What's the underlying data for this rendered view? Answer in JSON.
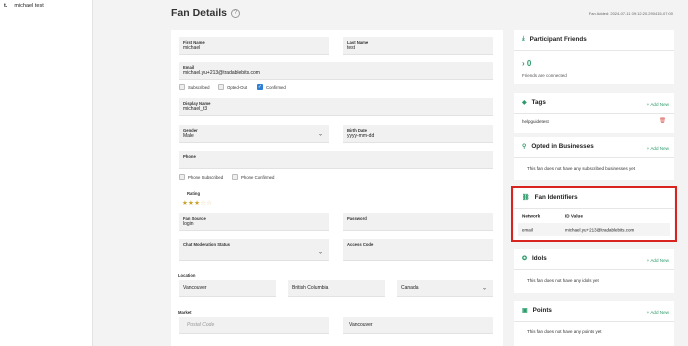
{
  "sidebar": {
    "items": [
      {
        "marker": "t.",
        "label": "michael test"
      }
    ]
  },
  "header": {
    "title": "Fan Details",
    "help_icon": "?",
    "fan_added": "Fan Added: 2024-07-11 09:12:20.290415-07:00"
  },
  "form": {
    "first_name": {
      "label": "First Name",
      "value": "michael"
    },
    "last_name": {
      "label": "Last Name",
      "value": "test"
    },
    "email": {
      "label": "Email",
      "value": "michael.yu+213@tradablebits.com"
    },
    "email_options": [
      {
        "label": "Subscribed",
        "checked": false
      },
      {
        "label": "Opted-Out",
        "checked": false
      },
      {
        "label": "Confirmed",
        "checked": true
      }
    ],
    "display_name": {
      "label": "Display Name",
      "value": "michael_t3"
    },
    "gender": {
      "label": "Gender",
      "value": "Male"
    },
    "birth_date": {
      "label": "Birth Date",
      "value": "yyyy-mm-dd"
    },
    "phone": {
      "label": "Phone",
      "value": ""
    },
    "phone_options": [
      {
        "label": "Phone Subscribed",
        "checked": false
      },
      {
        "label": "Phone Confirmed",
        "checked": false
      }
    ],
    "rating": {
      "label": "Rating",
      "value": 3,
      "max": 5
    },
    "fan_source": {
      "label": "Fan Source",
      "value": "login"
    },
    "password": {
      "label": "Password",
      "value": ""
    },
    "chat_status": {
      "label": "Chat Moderation Status",
      "value": ""
    },
    "access_code": {
      "label": "Access Code",
      "value": ""
    },
    "location": {
      "label": "Location",
      "city": "Vancouver",
      "region": "British Columbia",
      "country": "Canada"
    },
    "market": {
      "label": "Market",
      "postal_placeholder": "Postal Code",
      "value": "Vancouver"
    }
  },
  "cards": {
    "friends": {
      "title": "Participant Friends",
      "count": "0",
      "subtitle": "Friends are connected",
      "icon": "download-icon"
    },
    "tags": {
      "title": "Tags",
      "add": "+ Add New",
      "items": [
        "helpguidetest"
      ],
      "icon": "tag-icon"
    },
    "businesses": {
      "title": "Opted in Businesses",
      "add": "+ Add New",
      "empty": "This fan does not have any subscribed businesses yet",
      "icon": "person-icon"
    },
    "identifiers": {
      "title": "Fan Identifiers",
      "col_network": "Network",
      "col_id": "ID Value",
      "rows": [
        {
          "network": "email",
          "id": "michael.yu+213@tradablebits.com"
        }
      ],
      "icon": "link-icon"
    },
    "idols": {
      "title": "Idols",
      "add": "+ Add New",
      "empty": "This fan does not have any idols yet",
      "icon": "idol-icon"
    },
    "points": {
      "title": "Points",
      "add": "+ Add New",
      "empty": "This fan does not have any points yet",
      "icon": "points-icon"
    }
  },
  "colors": {
    "accent": "#2e9b6b",
    "highlight": "#d9231e",
    "checkbox": "#2d7fd6",
    "star": "#c9a227"
  }
}
